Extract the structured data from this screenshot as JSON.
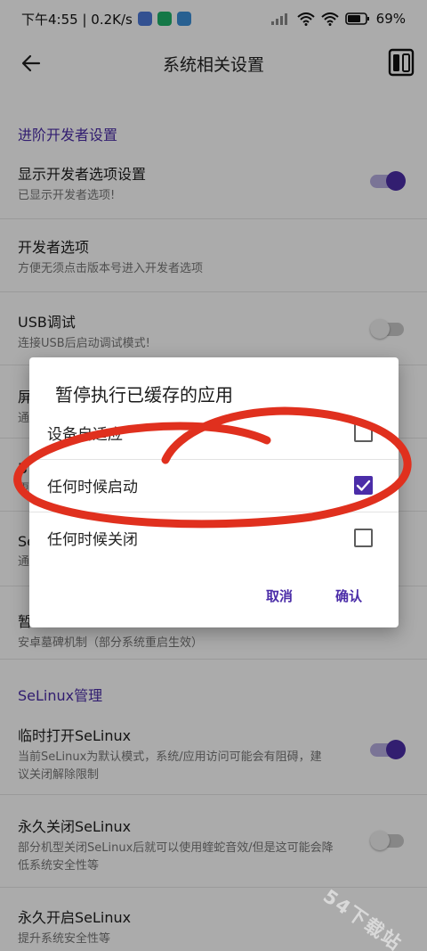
{
  "status_bar": {
    "time_speed": "下午4:55 | 0.2K/s",
    "battery": "69%",
    "app_icons": [
      "bubble-app-icon",
      "chat-app-icon",
      "game-app-icon"
    ]
  },
  "toolbar": {
    "title": "系统相关设置",
    "back_icon": "arrow-left-icon",
    "right_icon": "device-layout-icon"
  },
  "sections": [
    {
      "header": "进阶开发者设置",
      "items": [
        {
          "title": "显示开发者选项设置",
          "subtitle": "已显示开发者选项!",
          "switch": "on"
        },
        {
          "title": "开发者选项",
          "subtitle": "方便无须点击版本号进入开发者选项"
        },
        {
          "title": "USB调试",
          "subtitle": "连接USB后启动调试模式!",
          "switch": "off"
        },
        {
          "title": "屏",
          "subtitle": "通"
        },
        {
          "title": "B",
          "subtitle": "更"
        },
        {
          "title": "Se",
          "subtitle": "通"
        },
        {
          "title": "暂",
          "subtitle": "安卓墓碑机制（部分系统重启生效）"
        }
      ]
    },
    {
      "header": "SeLinux管理",
      "items": [
        {
          "title": "临时打开SeLinux",
          "subtitle": "当前SeLinux为默认模式，系统/应用访问可能会有阻碍，建议关闭解除限制",
          "switch": "on"
        },
        {
          "title": "永久关闭SeLinux",
          "subtitle": "部分机型关闭SeLinux后就可以使用蝰蛇音效/但是这可能会降低系统安全性等",
          "switch": "off"
        },
        {
          "title": "永久开启SeLinux",
          "subtitle": "提升系统安全性等"
        }
      ]
    }
  ],
  "dialog": {
    "title": "暂停执行已缓存的应用",
    "options": [
      {
        "label": "设备自适应",
        "checked": false
      },
      {
        "label": "任何时候启动",
        "checked": true
      },
      {
        "label": "任何时候关闭",
        "checked": false
      }
    ],
    "cancel_label": "取消",
    "confirm_label": "确认"
  },
  "watermark": "54下载站",
  "colors": {
    "accent": "#4b2da8",
    "annotation": "#e0301e",
    "scrim": "rgba(0,0,0,0.33)"
  }
}
